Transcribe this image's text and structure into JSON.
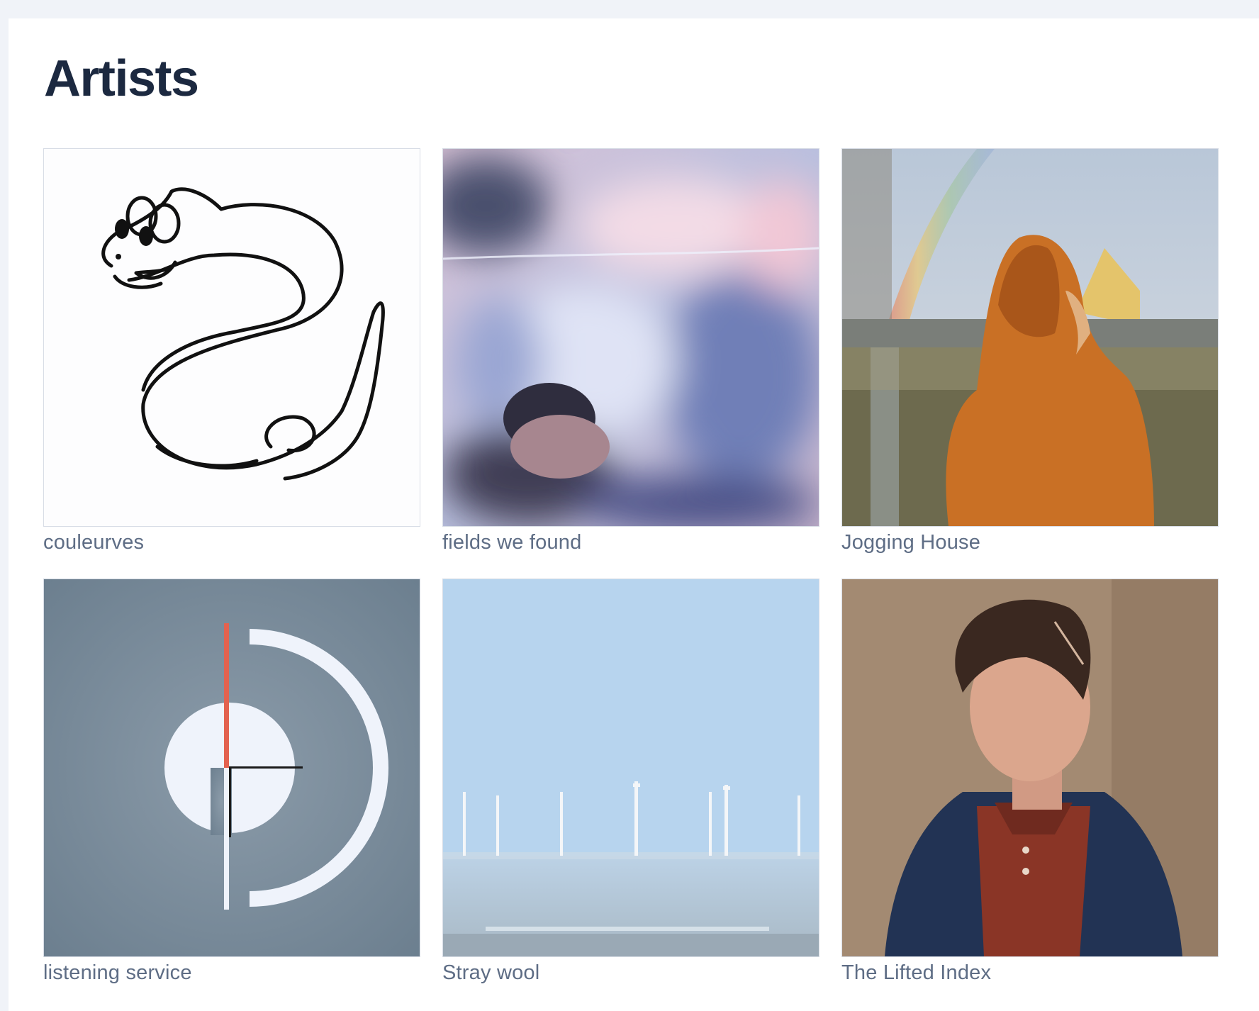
{
  "page": {
    "title": "Artists"
  },
  "artists": [
    {
      "name": "couleurves",
      "image": "snake-drawing-icon"
    },
    {
      "name": "fields we found",
      "image": "blurred-flower-photo"
    },
    {
      "name": "Jogging House",
      "image": "hooded-person-rainbow-photo"
    },
    {
      "name": "listening service",
      "image": "abstract-circle-logo"
    },
    {
      "name": "Stray wool",
      "image": "wind-turbines-sea-photo"
    },
    {
      "name": "The Lifted Index",
      "image": "man-portrait-photo"
    }
  ],
  "colors": {
    "background": "#f0f3f8",
    "panel": "#ffffff",
    "title": "#1c2940",
    "caption": "#5e6d85"
  }
}
